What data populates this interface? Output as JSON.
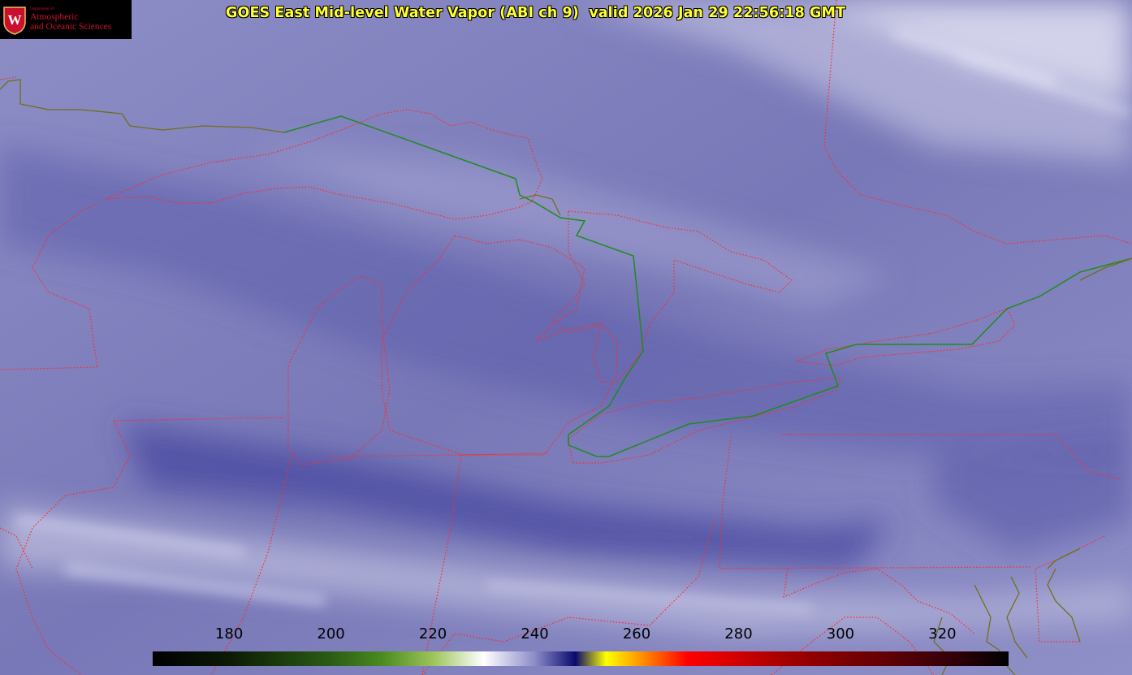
{
  "title": "GOES East Mid-level Water Vapor (ABI ch 9)  valid 2026 Jan 29 22:56:18 GMT",
  "logo": {
    "line1": "Department of",
    "line2": "Atmospheric",
    "line3": "and Oceanic Sciences",
    "seal_letter": "W",
    "icon": "uw-seal-icon"
  },
  "colorbar": {
    "tick_labels": [
      "180",
      "200",
      "220",
      "240",
      "260",
      "280",
      "300",
      "320"
    ],
    "tick_values": [
      180,
      200,
      220,
      240,
      260,
      280,
      300,
      320
    ],
    "range": [
      165,
      333
    ],
    "stops": [
      {
        "v": 165,
        "c": "#000000"
      },
      {
        "v": 180,
        "c": "#0c1a04"
      },
      {
        "v": 200,
        "c": "#2b5c15"
      },
      {
        "v": 210,
        "c": "#4a8a22"
      },
      {
        "v": 220,
        "c": "#9cc45a"
      },
      {
        "v": 230,
        "c": "#ffffff"
      },
      {
        "v": 240,
        "c": "#8c8cc8"
      },
      {
        "v": 248,
        "c": "#0a0a6e"
      },
      {
        "v": 254,
        "c": "#ffff00"
      },
      {
        "v": 262,
        "c": "#ff8000"
      },
      {
        "v": 270,
        "c": "#ff0000"
      },
      {
        "v": 290,
        "c": "#a00000"
      },
      {
        "v": 320,
        "c": "#3a0008"
      },
      {
        "v": 333,
        "c": "#000000"
      }
    ]
  },
  "colors": {
    "background": "#8c8cc4",
    "state_borders": "#ff2a2a",
    "intl_border": "#1a8c1a",
    "coast": "#6b6b1a",
    "title": "#ffff33"
  }
}
